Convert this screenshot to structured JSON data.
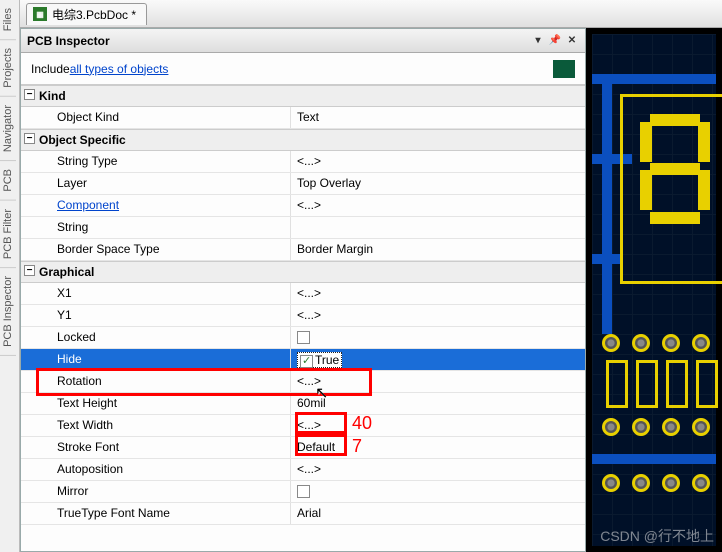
{
  "side_tabs": [
    "Files",
    "Projects",
    "Navigator",
    "PCB",
    "PCB Filter",
    "PCB Inspector"
  ],
  "doc_tab": "电综3.PcbDoc *",
  "inspector": {
    "title": "PCB Inspector",
    "include_prefix": "Include ",
    "include_link": "all types of objects",
    "sections": {
      "kind": {
        "title": "Kind",
        "rows": [
          {
            "label": "Object Kind",
            "value": "Text"
          }
        ]
      },
      "object_specific": {
        "title": "Object Specific",
        "rows": [
          {
            "label": "String Type",
            "value": "<...>"
          },
          {
            "label": "Layer",
            "value": "Top Overlay"
          },
          {
            "label": "Component",
            "value": "<...>",
            "is_link": true
          },
          {
            "label": "String",
            "value": ""
          },
          {
            "label": "Border Space Type",
            "value": "Border Margin"
          }
        ]
      },
      "graphical": {
        "title": "Graphical",
        "rows": [
          {
            "label": "X1",
            "value": "<...>"
          },
          {
            "label": "Y1",
            "value": "<...>"
          },
          {
            "label": "Locked",
            "checkbox": true,
            "checked": false
          },
          {
            "label": "Hide",
            "checkbox": true,
            "checked": true,
            "value": "True",
            "selected": true
          },
          {
            "label": "Rotation",
            "value": "<...>"
          },
          {
            "label": "Text Height",
            "value": "60mil"
          },
          {
            "label": "Text Width",
            "value": "<...>"
          },
          {
            "label": "Stroke Font",
            "value": "Default"
          },
          {
            "label": "Autoposition",
            "value": "<...>"
          },
          {
            "label": "Mirror",
            "checkbox": true,
            "checked": false
          },
          {
            "label": "TrueType Font Name",
            "value": "Arial"
          }
        ]
      }
    }
  },
  "annotations": {
    "height_note": "40",
    "width_note": "7"
  },
  "watermark": "CSDN @行不地上"
}
